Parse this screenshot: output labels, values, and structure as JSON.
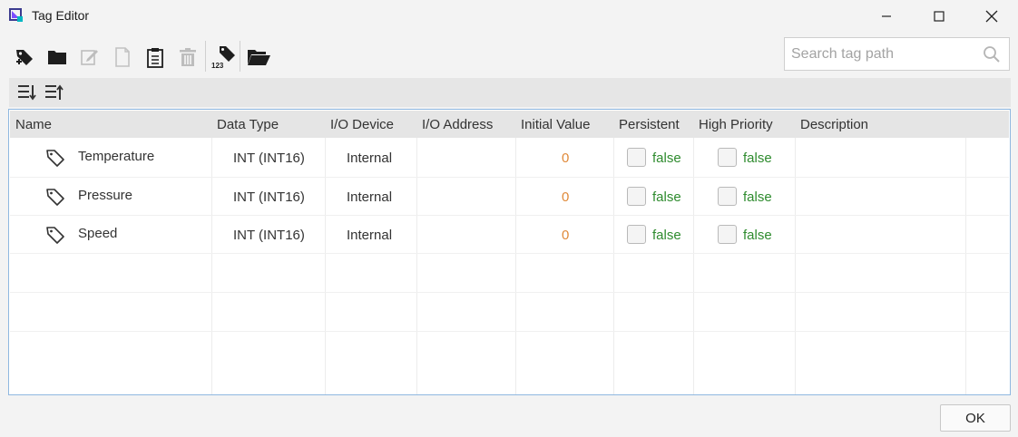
{
  "window": {
    "title": "Tag Editor"
  },
  "toolbar": {
    "buttons": [
      {
        "icon": "add-tag-icon",
        "enabled": true
      },
      {
        "icon": "folder-icon",
        "enabled": true
      },
      {
        "icon": "edit-icon",
        "enabled": false
      },
      {
        "icon": "copy-icon",
        "enabled": false
      },
      {
        "icon": "paste-icon",
        "enabled": true
      },
      {
        "icon": "delete-icon",
        "enabled": false
      },
      {
        "icon": "tag-123-icon",
        "enabled": true
      },
      {
        "icon": "open-folder-icon",
        "enabled": true
      }
    ],
    "tag123_label": "123"
  },
  "search": {
    "placeholder": "Search tag path",
    "value": ""
  },
  "grid": {
    "columns": [
      "Name",
      "Data Type",
      "I/O Device",
      "I/O Address",
      "Initial Value",
      "Persistent",
      "High Priority",
      "Description"
    ],
    "rows": [
      {
        "name": "Temperature",
        "data_type": "INT (INT16)",
        "io_device": "Internal",
        "io_address": "",
        "initial_value": "0",
        "persistent": "false",
        "high_priority": "false",
        "description": ""
      },
      {
        "name": "Pressure",
        "data_type": "INT (INT16)",
        "io_device": "Internal",
        "io_address": "",
        "initial_value": "0",
        "persistent": "false",
        "high_priority": "false",
        "description": ""
      },
      {
        "name": "Speed",
        "data_type": "INT (INT16)",
        "io_device": "Internal",
        "io_address": "",
        "initial_value": "0",
        "persistent": "false",
        "high_priority": "false",
        "description": ""
      }
    ]
  },
  "footer": {
    "ok_label": "OK"
  },
  "colors": {
    "grid_border": "#8fb8e0",
    "numeric": "#e08a3a",
    "boolean": "#2e8b2e",
    "accent_icon": "#6b46c1"
  }
}
